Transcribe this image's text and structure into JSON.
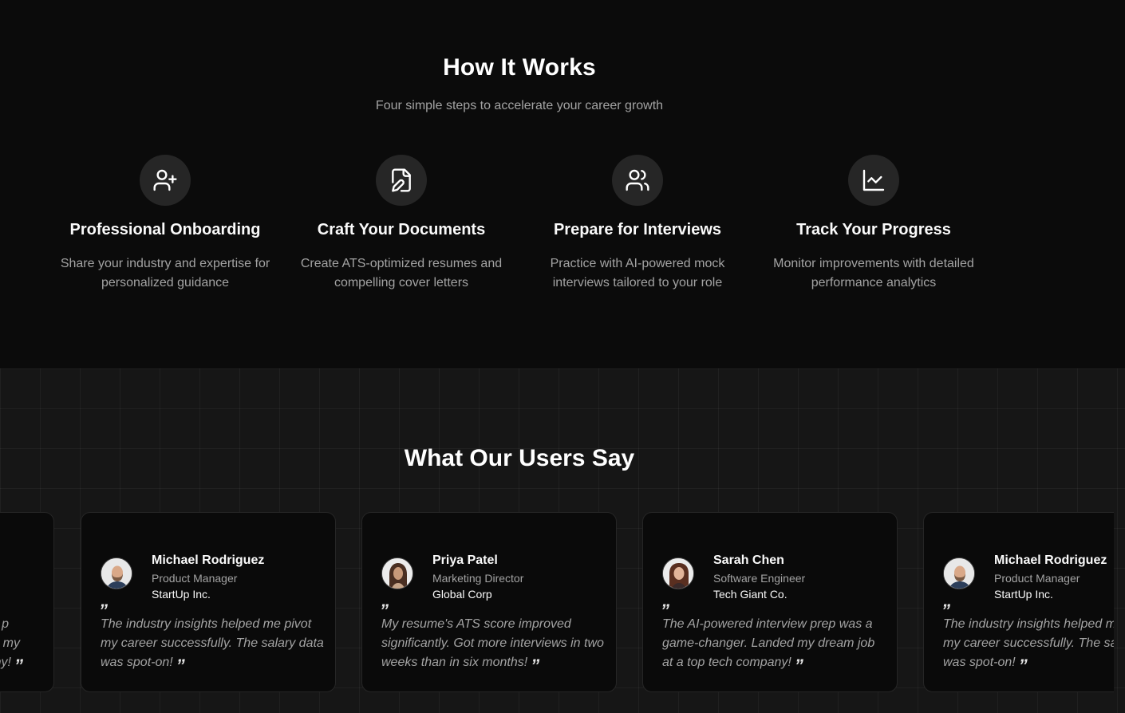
{
  "how_it_works": {
    "title": "How It Works",
    "subtitle": "Four simple steps to accelerate your career growth",
    "steps": [
      {
        "icon": "user-plus-icon",
        "title": "Professional Onboarding",
        "description": "Share your industry and expertise for personalized guidance"
      },
      {
        "icon": "file-pen-icon",
        "title": "Craft Your Documents",
        "description": "Create ATS-optimized resumes and compelling cover letters"
      },
      {
        "icon": "users-icon",
        "title": "Prepare for Interviews",
        "description": "Practice with AI-powered mock interviews tailored to your role"
      },
      {
        "icon": "line-chart-icon",
        "title": "Track Your Progress",
        "description": "Monitor improvements with detailed performance analytics"
      }
    ]
  },
  "testimonials": {
    "title": "What Our Users Say",
    "partial_left": {
      "lines": [
        "p",
        "my",
        "any!"
      ]
    },
    "cards": [
      {
        "name": "Michael Rodriguez",
        "role": "Product Manager",
        "company": "StartUp Inc.",
        "quote": "The industry insights helped me pivot my career successfully. The salary data was spot-on!",
        "avatar": "avatar-man-beard"
      },
      {
        "name": "Priya Patel",
        "role": "Marketing Director",
        "company": "Global Corp",
        "quote": "My resume's ATS score improved significantly. Got more interviews in two weeks than in six months!",
        "avatar": "avatar-woman-long-hair"
      },
      {
        "name": "Sarah Chen",
        "role": "Software Engineer",
        "company": "Tech Giant Co.",
        "quote": "The AI-powered interview prep was a game-changer. Landed my dream job at a top tech company!",
        "avatar": "avatar-woman-brown-hair"
      },
      {
        "name": "Michael Rodriguez",
        "role": "Product Manager",
        "company": "StartUp Inc.",
        "quote": "The industry insights helped me pivot my career successfully. The salary data was spot-on!",
        "avatar": "avatar-man-beard"
      }
    ],
    "quote_mark_open": "”",
    "quote_mark_close": "”"
  },
  "colors": {
    "background": "#0b0b0b",
    "section_alt": "#161616",
    "card_bg": "#0a0a0a",
    "muted_text": "#a3a3a3",
    "icon_circle": "#262626"
  }
}
